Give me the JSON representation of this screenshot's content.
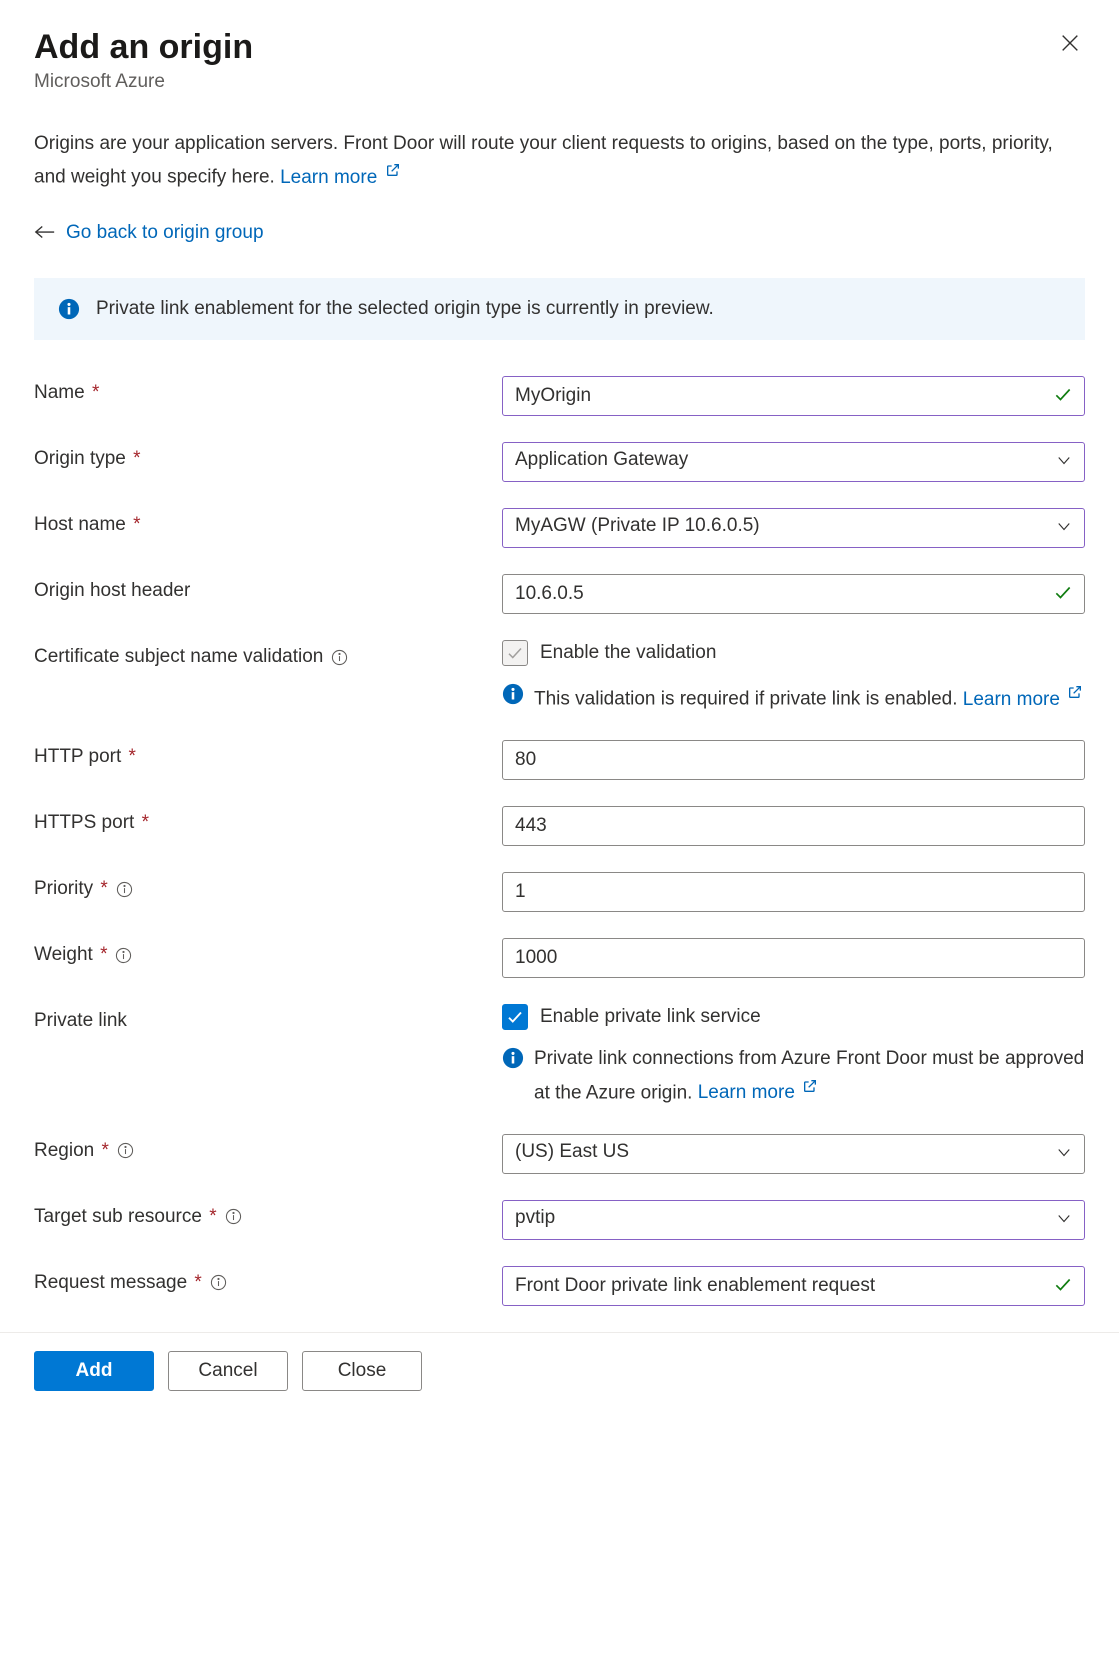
{
  "header": {
    "title": "Add an origin",
    "subtitle": "Microsoft Azure"
  },
  "description": {
    "text": "Origins are your application servers. Front Door will route your client requests to origins, based on the type, ports, priority, and weight you specify here. ",
    "learn_more": "Learn more"
  },
  "back_link": "Go back to origin group",
  "banner": "Private link enablement for the selected origin type is currently in preview.",
  "labels": {
    "name": "Name",
    "origin_type": "Origin type",
    "host_name": "Host name",
    "origin_host_header": "Origin host header",
    "cert_validation": "Certificate subject name validation",
    "enable_validation": "Enable the validation",
    "validation_info": "This validation is required if private link is enabled. ",
    "learn_more": "Learn more",
    "http_port": "HTTP port",
    "https_port": "HTTPS port",
    "priority": "Priority",
    "weight": "Weight",
    "private_link": "Private link",
    "enable_private_link": "Enable private link service",
    "private_link_info": "Private link connections from Azure Front Door must be approved at the Azure origin. ",
    "region": "Region",
    "target_sub_resource": "Target sub resource",
    "request_message": "Request message"
  },
  "values": {
    "name": "MyOrigin",
    "origin_type": "Application Gateway",
    "host_name": "MyAGW (Private IP 10.6.0.5)",
    "origin_host_header": "10.6.0.5",
    "http_port": "80",
    "https_port": "443",
    "priority": "1",
    "weight": "1000",
    "region": "(US) East US",
    "target_sub_resource": "pvtip",
    "request_message": "Front Door private link enablement request"
  },
  "footer": {
    "add": "Add",
    "cancel": "Cancel",
    "close": "Close"
  }
}
